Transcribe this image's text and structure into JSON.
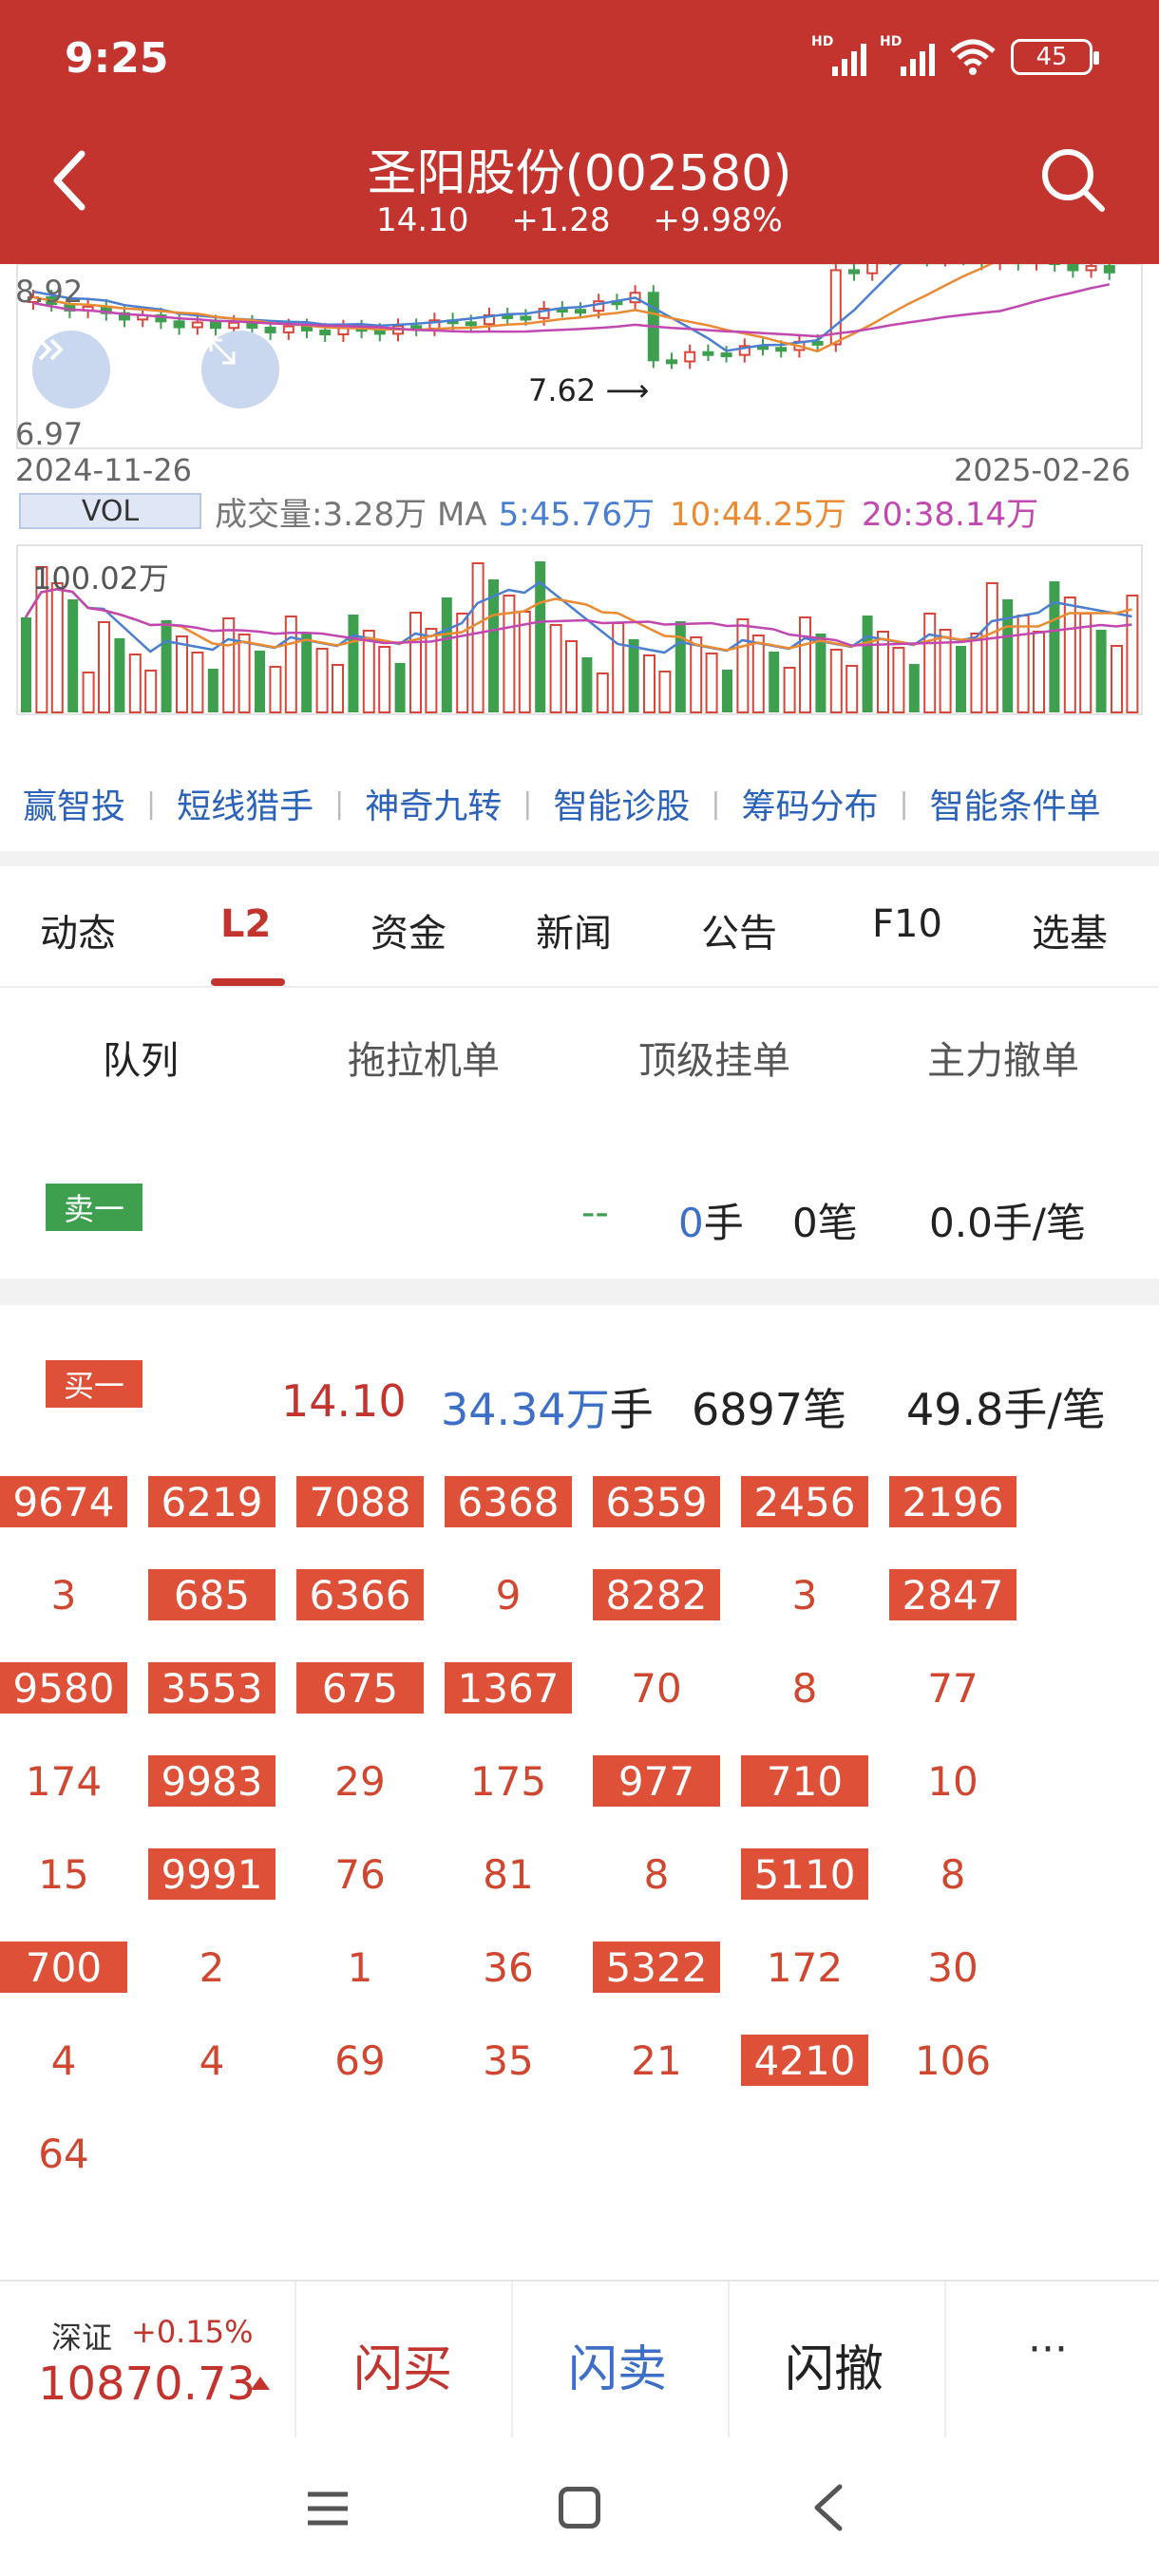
{
  "status": {
    "time": "9:25",
    "signal1": "HD",
    "signal2": "HD",
    "battery": "45"
  },
  "header": {
    "title": "圣阳股份(002580)",
    "price": "14.10",
    "change": "+1.28",
    "pct": "+9.98%"
  },
  "chart": {
    "y_top_label": "8.92",
    "y_bottom_label": "6.97",
    "low_annotation": "7.62",
    "date_start": "2024-11-26",
    "date_end": "2025-02-26",
    "vol_tag": "VOL",
    "vol_text": "成交量:3.28万 MA",
    "ma5": "5:45.76万",
    "ma10": "10:44.25万",
    "ma20": "20:38.14万",
    "vol_max_label": "100.02万",
    "colors": {
      "up": "#d8453a",
      "down": "#3ea04f",
      "ma5": "#4a7fd0",
      "ma10": "#ea8a32",
      "ma20": "#c048b0"
    }
  },
  "tools": [
    "赢智投",
    "短线猎手",
    "神奇九转",
    "智能诊股",
    "筹码分布",
    "智能条件单"
  ],
  "tabs": [
    "动态",
    "L2",
    "资金",
    "新闻",
    "公告",
    "F10",
    "选基"
  ],
  "active_tab": "L2",
  "subtabs": [
    "队列",
    "拖拉机单",
    "顶级挂单",
    "主力撤单"
  ],
  "active_subtab": "队列",
  "sell1": {
    "tag": "卖一",
    "price": "--",
    "qty_value": "0",
    "qty_unit": "手",
    "count": "0笔",
    "avg": "0.0手/笔"
  },
  "buy1": {
    "tag": "买一",
    "price": "14.10",
    "qty_value": "34.34万",
    "qty_unit": "手",
    "count": "6897笔",
    "avg": "49.8手/笔"
  },
  "queue": [
    [
      {
        "v": "9674",
        "h": true
      },
      {
        "v": "6219",
        "h": true
      },
      {
        "v": "7088",
        "h": true
      },
      {
        "v": "6368",
        "h": true
      },
      {
        "v": "6359",
        "h": true
      },
      {
        "v": "2456",
        "h": true
      },
      {
        "v": "2196",
        "h": true
      }
    ],
    [
      {
        "v": "3",
        "h": false
      },
      {
        "v": "685",
        "h": true
      },
      {
        "v": "6366",
        "h": true
      },
      {
        "v": "9",
        "h": false
      },
      {
        "v": "8282",
        "h": true
      },
      {
        "v": "3",
        "h": false
      },
      {
        "v": "2847",
        "h": true
      }
    ],
    [
      {
        "v": "9580",
        "h": true
      },
      {
        "v": "3553",
        "h": true
      },
      {
        "v": "675",
        "h": true
      },
      {
        "v": "1367",
        "h": true
      },
      {
        "v": "70",
        "h": false
      },
      {
        "v": "8",
        "h": false
      },
      {
        "v": "77",
        "h": false
      }
    ],
    [
      {
        "v": "174",
        "h": false
      },
      {
        "v": "9983",
        "h": true
      },
      {
        "v": "29",
        "h": false
      },
      {
        "v": "175",
        "h": false
      },
      {
        "v": "977",
        "h": true
      },
      {
        "v": "710",
        "h": true
      },
      {
        "v": "10",
        "h": false
      }
    ],
    [
      {
        "v": "15",
        "h": false
      },
      {
        "v": "9991",
        "h": true
      },
      {
        "v": "76",
        "h": false
      },
      {
        "v": "81",
        "h": false
      },
      {
        "v": "8",
        "h": false
      },
      {
        "v": "5110",
        "h": true
      },
      {
        "v": "8",
        "h": false
      }
    ],
    [
      {
        "v": "700",
        "h": true
      },
      {
        "v": "2",
        "h": false
      },
      {
        "v": "1",
        "h": false
      },
      {
        "v": "36",
        "h": false
      },
      {
        "v": "5322",
        "h": true
      },
      {
        "v": "172",
        "h": false
      },
      {
        "v": "30",
        "h": false
      }
    ],
    [
      {
        "v": "4",
        "h": false
      },
      {
        "v": "4",
        "h": false
      },
      {
        "v": "69",
        "h": false
      },
      {
        "v": "35",
        "h": false
      },
      {
        "v": "21",
        "h": false
      },
      {
        "v": "4210",
        "h": true
      },
      {
        "v": "106",
        "h": false
      }
    ],
    [
      {
        "v": "64",
        "h": false
      }
    ]
  ],
  "bottom": {
    "index_name": "深证",
    "index_change": "+0.15%",
    "index_value": "10870.73",
    "btn_buy": "闪买",
    "btn_sell": "闪卖",
    "btn_cancel": "闪撤",
    "btn_more": "···"
  }
}
